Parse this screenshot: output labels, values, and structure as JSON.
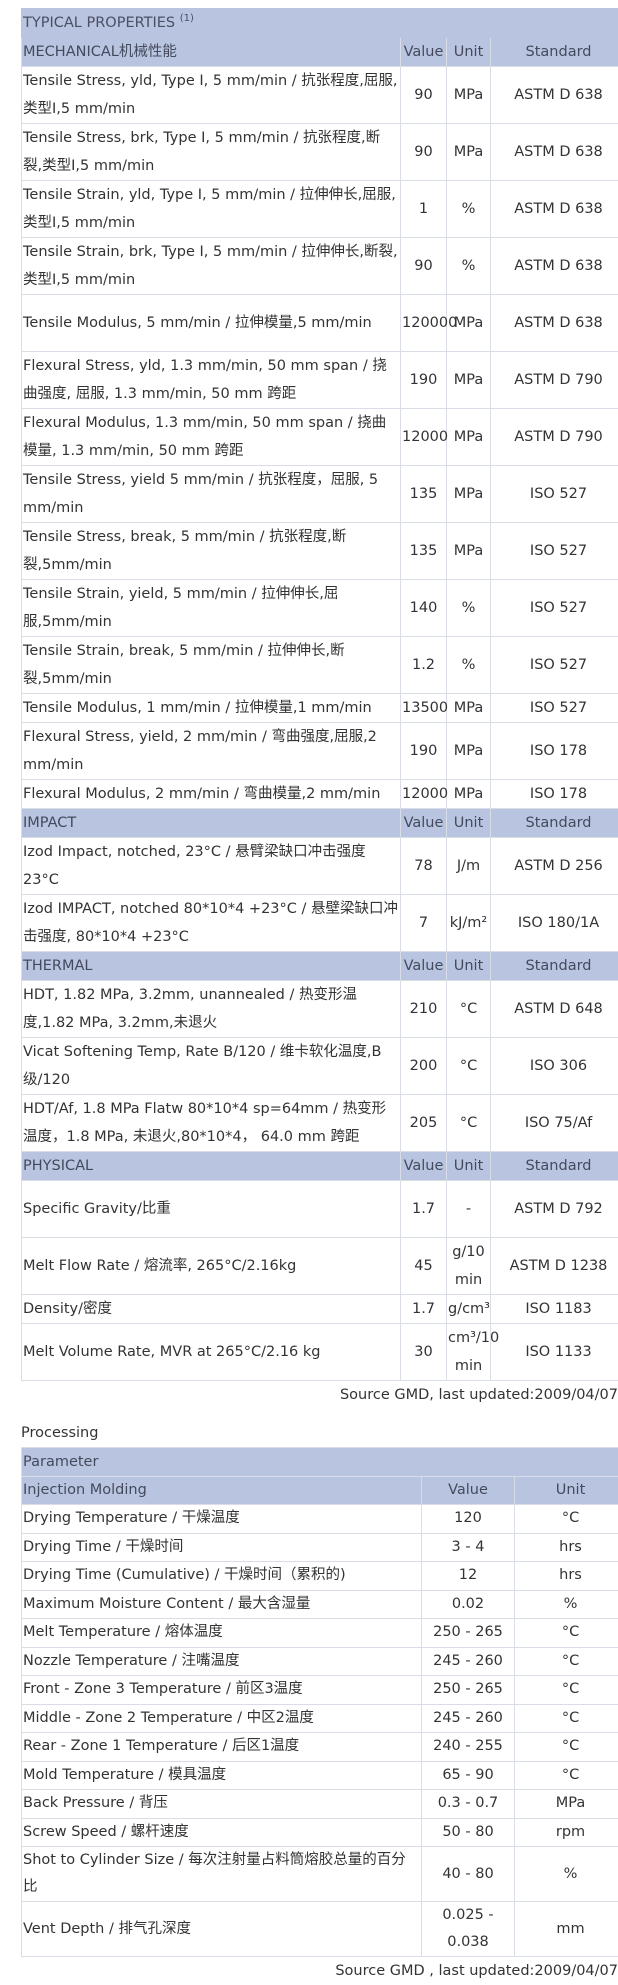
{
  "properties": {
    "title": "TYPICAL PROPERTIES",
    "title_note": "(1)",
    "sections": [
      {
        "name": "MECHANICAL机械性能",
        "headers": [
          "Value",
          "Unit",
          "Standard"
        ],
        "rows": [
          {
            "p": "Tensile Stress, yld, Type I, 5 mm/min / 抗张程度,屈服,类型I,5 mm/min",
            "v": "90",
            "u": "MPa",
            "s": "ASTM D 638",
            "tall": true
          },
          {
            "p": "Tensile Stress, brk, Type I, 5 mm/min / 抗张程度,断裂,类型I,5 mm/min",
            "v": "90",
            "u": "MPa",
            "s": "ASTM D 638",
            "tall": true
          },
          {
            "p": "Tensile Strain, yld, Type I, 5 mm/min / 拉伸伸长,屈服,类型I,5 mm/min",
            "v": "1",
            "u": "%",
            "s": "ASTM D 638",
            "tall": true
          },
          {
            "p": "Tensile Strain, brk, Type I, 5 mm/min / 拉伸伸长,断裂,类型I,5 mm/min",
            "v": "90",
            "u": "%",
            "s": "ASTM D 638",
            "tall": true
          },
          {
            "p": "Tensile Modulus, 5 mm/min / 拉伸模量,5 mm/min",
            "v": "120000",
            "u": "MPa",
            "s": "ASTM D 638",
            "tall": true
          },
          {
            "p": "Flexural Stress, yld, 1.3 mm/min, 50 mm span / 挠曲强度, 屈服, 1.3 mm/min, 50 mm 跨距",
            "v": "190",
            "u": "MPa",
            "s": "ASTM D 790",
            "tall": true
          },
          {
            "p": "Flexural Modulus, 1.3 mm/min, 50 mm span / 挠曲模量, 1.3 mm/min, 50 mm 跨距",
            "v": "12000",
            "u": "MPa",
            "s": "ASTM D 790",
            "tall": true
          },
          {
            "p": "Tensile Stress, yield 5 mm/min / 抗张程度，屈服, 5 mm/min",
            "v": "135",
            "u": "MPa",
            "s": "ISO 527",
            "tall": false
          },
          {
            "p": "Tensile Stress, break, 5 mm/min / 抗张程度,断裂,5mm/min",
            "v": "135",
            "u": "MPa",
            "s": "ISO 527",
            "tall": false
          },
          {
            "p": "Tensile Strain, yield, 5 mm/min / 拉伸伸长,屈服,5mm/min",
            "v": "140",
            "u": "%",
            "s": "ISO 527",
            "tall": false
          },
          {
            "p": "Tensile Strain, break, 5 mm/min / 拉伸伸长,断裂,5mm/min",
            "v": "1.2",
            "u": "%",
            "s": "ISO 527",
            "tall": false
          },
          {
            "p": "Tensile Modulus, 1 mm/min / 拉伸模量,1 mm/min",
            "v": "13500",
            "u": "MPa",
            "s": "ISO 527",
            "tall": false
          },
          {
            "p": "Flexural Stress, yield, 2 mm/min / 弯曲强度,屈服,2 mm/min",
            "v": "190",
            "u": "MPa",
            "s": "ISO 178",
            "tall": false
          },
          {
            "p": "Flexural Modulus, 2 mm/min / 弯曲模量,2 mm/min",
            "v": "12000",
            "u": "MPa",
            "s": "ISO 178",
            "tall": false
          }
        ]
      },
      {
        "name": "IMPACT",
        "headers": [
          "Value",
          "Unit",
          "Standard"
        ],
        "rows": [
          {
            "p": "Izod Impact, notched, 23°C / 悬臂梁缺口冲击强度23°C",
            "v": "78",
            "u": "J/m",
            "s": "ASTM D 256",
            "tall": true
          },
          {
            "p": "Izod IMPACT, notched 80*10*4 +23°C / 悬壁梁缺口冲击强度, 80*10*4 +23°C",
            "v": "7",
            "u": "kJ/m²",
            "s": "ISO 180/1A",
            "tall": true
          }
        ]
      },
      {
        "name": "THERMAL",
        "headers": [
          "Value",
          "Unit",
          "Standard"
        ],
        "rows": [
          {
            "p": "HDT, 1.82 MPa, 3.2mm, unannealed / 热变形温度,1.82 MPa, 3.2mm,未退火",
            "v": "210",
            "u": "°C",
            "s": "ASTM D 648",
            "tall": true
          },
          {
            "p": "Vicat Softening Temp, Rate B/120 / 维卡软化温度,B级/120",
            "v": "200",
            "u": "°C",
            "s": "ISO 306",
            "tall": false
          },
          {
            "p": "HDT/Af, 1.8 MPa Flatw 80*10*4 sp=64mm / 热变形温度，1.8 MPa, 未退火,80*10*4， 64.0 mm 跨距",
            "v": "205",
            "u": "°C",
            "s": "ISO 75/Af",
            "tall": true
          }
        ]
      },
      {
        "name": "PHYSICAL",
        "headers": [
          "Value",
          "Unit",
          "Standard"
        ],
        "rows": [
          {
            "p": "Specific Gravity/比重",
            "v": "1.7",
            "u": "-",
            "s": "ASTM D 792",
            "tall": true
          },
          {
            "p": "Melt Flow Rate / 熔流率, 265°C/2.16kg",
            "v": "45",
            "u": "g/10 min",
            "s": "ASTM D 1238",
            "tall": true
          },
          {
            "p": "Density/密度",
            "v": "1.7",
            "u": "g/cm³",
            "s": "ISO 1183",
            "tall": false
          },
          {
            "p": "Melt Volume Rate, MVR at 265°C/2.16 kg",
            "v": "30",
            "u": "cm³/10 min",
            "s": "ISO 1133",
            "tall": true
          }
        ]
      }
    ],
    "source": "Source GMD, last updated:2009/04/07"
  },
  "processing": {
    "title": "Processing",
    "param_header": "Parameter",
    "section": "Injection Molding",
    "headers": [
      "Value",
      "Unit"
    ],
    "rows": [
      {
        "p": "Drying Temperature / 干燥温度",
        "v": "120",
        "u": "°C"
      },
      {
        "p": "Drying Time / 干燥时间",
        "v": "3 - 4",
        "u": "hrs"
      },
      {
        "p": "Drying Time (Cumulative) / 干燥时间（累积的)",
        "v": "12",
        "u": "hrs"
      },
      {
        "p": "Maximum Moisture Content / 最大含湿量",
        "v": "0.02",
        "u": "%"
      },
      {
        "p": "Melt Temperature / 熔体温度",
        "v": "250 - 265",
        "u": "°C"
      },
      {
        "p": "Nozzle Temperature / 注嘴温度",
        "v": "245 - 260",
        "u": "°C"
      },
      {
        "p": "Front - Zone 3 Temperature / 前区3温度",
        "v": "250 - 265",
        "u": "°C"
      },
      {
        "p": "Middle - Zone 2 Temperature / 中区2温度",
        "v": "245 - 260",
        "u": "°C"
      },
      {
        "p": "Rear - Zone 1 Temperature / 后区1温度",
        "v": "240 - 255",
        "u": "°C"
      },
      {
        "p": "Mold Temperature / 模具温度",
        "v": "65 - 90",
        "u": "°C"
      },
      {
        "p": "Back Pressure / 背压",
        "v": "0.3 - 0.7",
        "u": "MPa"
      },
      {
        "p": "Screw Speed / 螺杆速度",
        "v": "50 - 80",
        "u": "rpm"
      },
      {
        "p": "Shot to Cylinder Size / 每次注射量占料筒熔胶总量的百分比",
        "v": "40 - 80",
        "u": "%"
      },
      {
        "p": "Vent Depth / 排气孔深度",
        "v": "0.025 - 0.038",
        "u": "mm"
      }
    ],
    "source": "Source GMD , last updated:2009/04/07"
  }
}
